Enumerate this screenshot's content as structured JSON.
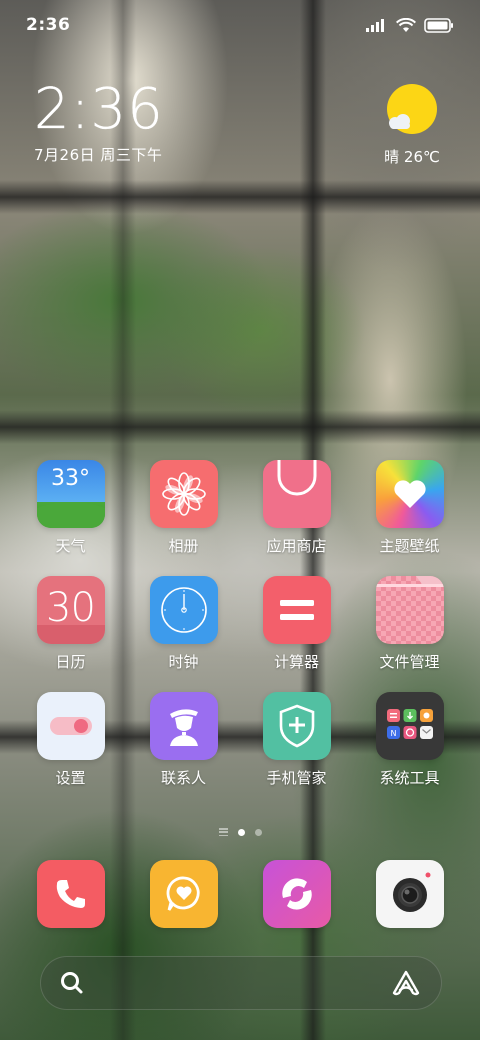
{
  "status_bar": {
    "time": "2:36",
    "icons": [
      "signal-icon",
      "wifi-icon",
      "battery-icon"
    ]
  },
  "clock_widget": {
    "time": "2:36",
    "date": "7月26日 周三下午"
  },
  "weather_widget": {
    "icon": "sunny-cloud-icon",
    "text": "晴 26℃"
  },
  "apps": [
    {
      "label": "天气",
      "icon": "weather-app-icon",
      "icon_text": "33°"
    },
    {
      "label": "相册",
      "icon": "gallery-flower-icon"
    },
    {
      "label": "应用商店",
      "icon": "app-store-bag-icon"
    },
    {
      "label": "主题壁纸",
      "icon": "themes-heart-icon"
    },
    {
      "label": "日历",
      "icon": "calendar-icon",
      "icon_text": "30"
    },
    {
      "label": "时钟",
      "icon": "clock-icon"
    },
    {
      "label": "计算器",
      "icon": "calculator-icon"
    },
    {
      "label": "文件管理",
      "icon": "file-folder-icon"
    },
    {
      "label": "设置",
      "icon": "settings-toggle-icon"
    },
    {
      "label": "联系人",
      "icon": "contacts-person-icon"
    },
    {
      "label": "手机管家",
      "icon": "security-shield-icon"
    },
    {
      "label": "系统工具",
      "icon": "system-tools-folder-icon"
    }
  ],
  "page_indicator": {
    "pages": 2,
    "current": 1
  },
  "dock": [
    {
      "icon": "phone-icon"
    },
    {
      "icon": "messages-icon"
    },
    {
      "icon": "browser-icon"
    },
    {
      "icon": "camera-icon"
    }
  ],
  "search_bar": {
    "left_icon": "search-icon",
    "right_icon": "assistant-icon"
  },
  "colors": {
    "weather_top": "#3f8ee8",
    "weather_grass": "#4aa83a",
    "gallery": "#f66d6f",
    "app_store": "#f0708a",
    "calendar": "#e5727d",
    "clock": "#3d9bec",
    "calculator": "#f35f6b",
    "files": "#f7a7b4",
    "settings": "#eaf1fb",
    "contacts": "#9a6ef0",
    "security": "#52c0a2",
    "tools": "#383838",
    "phone": "#f45c63",
    "messages": "#f8b531",
    "browser": "#d653c3",
    "camera": "#f5f5f5",
    "sun": "#fcd615"
  }
}
